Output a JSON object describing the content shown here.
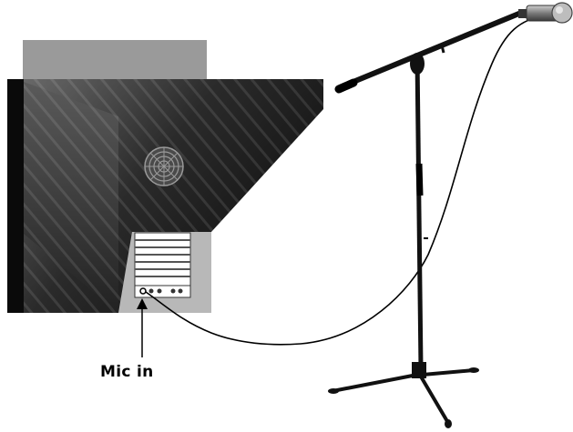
{
  "labels": {
    "mic_input": "Mic in"
  },
  "components": {
    "computer": "computer-tower",
    "microphone": "microphone-icon",
    "stand": "boom-mic-stand",
    "fan": "fan-grille-icon",
    "io_panel": "rear-io-panel",
    "cable": "mic-cable"
  },
  "colors": {
    "background": "#ffffff",
    "case_dark": "#1a1a1a",
    "case_top": "#9a9a9a",
    "io_panel": "#b8b8b8",
    "stand": "#111111",
    "cable": "#000000",
    "mic_body": "#8c8c8c"
  }
}
